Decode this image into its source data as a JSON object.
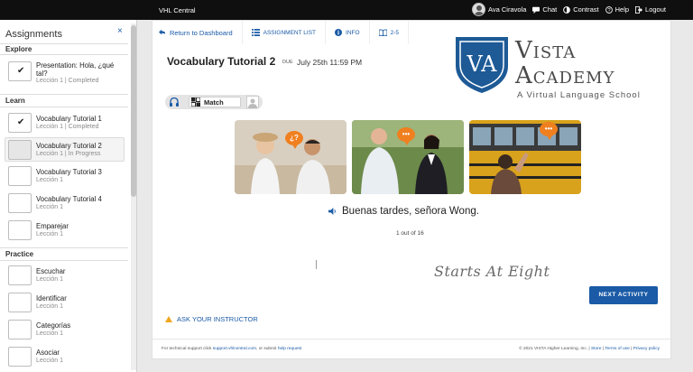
{
  "topbar": {
    "brand": "VHL Central",
    "user_name": "Ava Ciravola",
    "chat": "Chat",
    "contrast": "Contrast",
    "help": "Help",
    "logout": "Logout"
  },
  "sidebar": {
    "title": "Assignments",
    "close": "×",
    "sections": {
      "explore": "Explore",
      "learn": "Learn",
      "practice": "Practice"
    },
    "explore_items": [
      {
        "title": "Presentation: Hola, ¿qué tal?",
        "sub": "Lección 1 | Completed",
        "done": true
      }
    ],
    "learn_items": [
      {
        "title": "Vocabulary Tutorial 1",
        "sub": "Lección 1 | Completed",
        "done": true
      },
      {
        "title": "Vocabulary Tutorial 2",
        "sub": "Lección 1 | In Progress",
        "done": false
      },
      {
        "title": "Vocabulary Tutorial 3",
        "sub": "Lección 1",
        "done": false
      },
      {
        "title": "Vocabulary Tutorial 4",
        "sub": "Lección 1",
        "done": false
      },
      {
        "title": "Emparejar",
        "sub": "Lección 1",
        "done": false
      }
    ],
    "practice_items": [
      {
        "title": "Escuchar",
        "sub": "Lección 1"
      },
      {
        "title": "Identificar",
        "sub": "Lección 1"
      },
      {
        "title": "Categorías",
        "sub": "Lección 1"
      },
      {
        "title": "Asociar",
        "sub": "Lección 1"
      }
    ]
  },
  "toolbar": {
    "return": "Return to Dashboard",
    "assignment_list": "ASSIGNMENT LIST",
    "info": "INFO",
    "page": "2-5"
  },
  "assignment": {
    "title": "Vocabulary Tutorial 2",
    "due_label": "DUE",
    "due_date": "July 25th 11:59 PM"
  },
  "logo": {
    "line1": "Vista",
    "line2": "Academy",
    "tagline": "A Virtual Language School"
  },
  "mode": {
    "label": "Match"
  },
  "pictures": [
    {
      "bubble": "¿?"
    },
    {
      "bubble": "•••"
    },
    {
      "bubble": "•••"
    }
  ],
  "phrase": "Buenas tardes, señora Wong.",
  "counter": "1 out of 16",
  "watermark": "Starts At Eight",
  "next_button": "NEXT ACTIVITY",
  "ask_instructor": "ASK YOUR INSTRUCTOR",
  "footer": {
    "left_prefix": "For technical support click",
    "left_link1": "support.vhlcentral.com",
    "left_mid": ", or submit",
    "left_link2": "help request",
    "right_copy": "© 2021 VISTA Higher Learning, Inc. |",
    "right_store": "Store",
    "right_terms": "Terms of use",
    "right_privacy": "Privacy policy"
  },
  "colors": {
    "accent": "#1a5aa6",
    "bubble": "#f07f1f",
    "topbar": "#0f0f0f"
  }
}
